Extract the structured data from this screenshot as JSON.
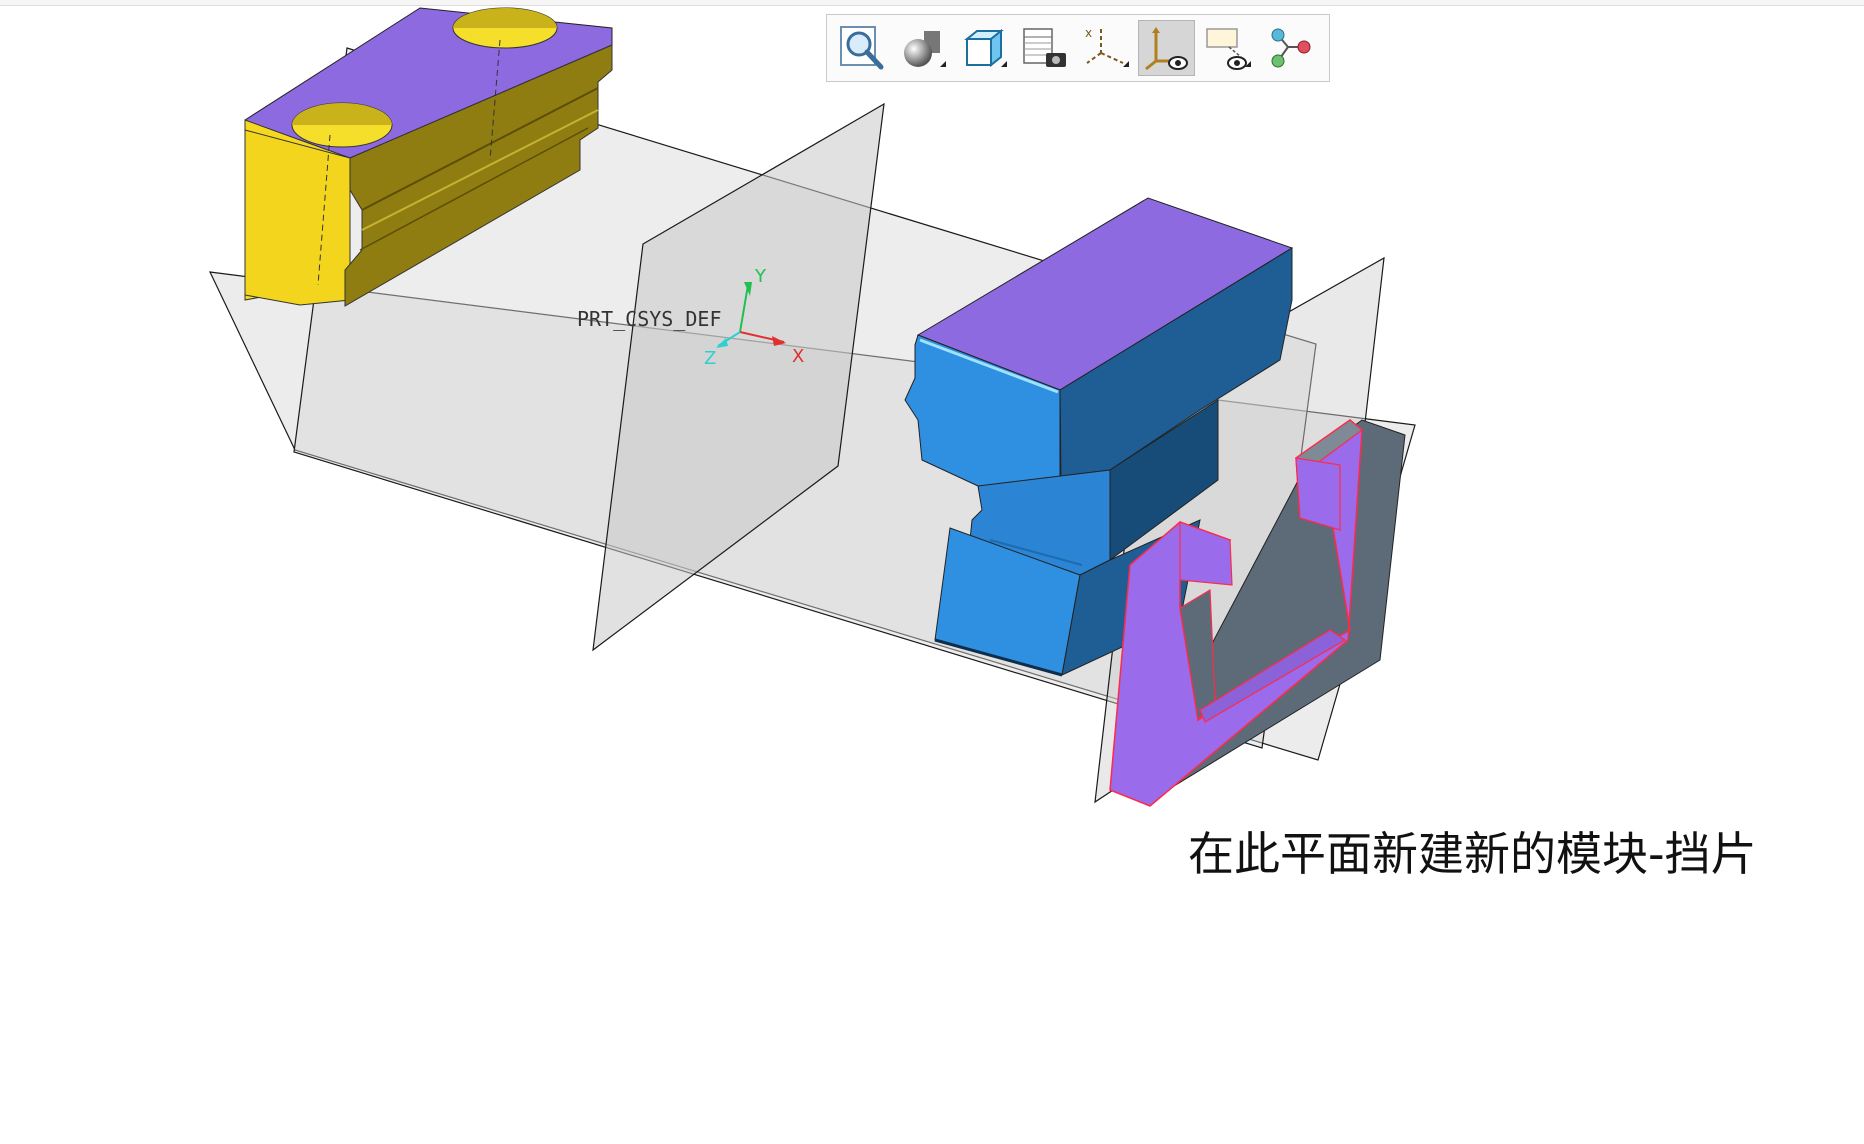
{
  "viewport": {
    "csys_name": "PRT_CSYS_DEF",
    "axes": {
      "x": "X",
      "y": "Y",
      "z": "Z"
    },
    "caption": "在此平面新建新的模块-挡片",
    "colors": {
      "yellow_part": "#f5d81f",
      "purple_face": "#8e6ae0",
      "blue_part": "#2f8fe0",
      "gray_part": "#5d6b78",
      "highlight_edge": "#ff2a4a",
      "plane_fill": "#d8d8d8"
    }
  },
  "toolbar": {
    "buttons": [
      {
        "name": "zoom-to-fit",
        "icon": "zoom-magnifier-icon"
      },
      {
        "name": "display-style",
        "icon": "shaded-sphere-icon"
      },
      {
        "name": "saved-orientations",
        "icon": "cube-view-icon"
      },
      {
        "name": "view-manager",
        "icon": "table-camera-icon"
      },
      {
        "name": "datum-display-filters",
        "icon": "datum-filter-icon"
      },
      {
        "name": "csys-display",
        "icon": "csys-eye-icon",
        "active": true
      },
      {
        "name": "annotation-display",
        "icon": "annotation-eye-icon"
      },
      {
        "name": "spin-center",
        "icon": "spin-center-icon"
      }
    ]
  }
}
